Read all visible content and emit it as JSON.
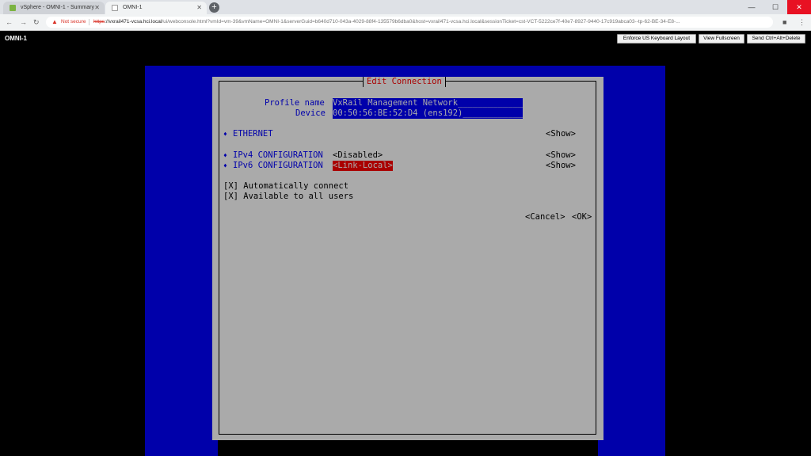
{
  "browser": {
    "tabs": [
      {
        "title": "vSphere - OMNI-1 - Summary",
        "active": false
      },
      {
        "title": "OMNI-1",
        "active": true
      }
    ],
    "security_label": "Not secure",
    "url_scheme": "https",
    "url_host": "://vxrail471-vcsa.hci.local",
    "url_rest": "/ui/webconsole.html?vmId=vm-39&vmName=OMNI-1&serverGuid=b640d710-043a-4029-88f4-135579b6dba0&host=vxrail471-vcsa.hci.local&sessionTicket=cst-VCT-5222ce7f-40e7-8927-9440-17c919abca03--tp-62-BE-34-E8-..."
  },
  "console": {
    "vm_name": "OMNI-1",
    "buttons": {
      "keyboard": "Enforce US Keyboard Layout",
      "fullscreen": "View Fullscreen",
      "cad": "Send Ctrl+Alt+Delete"
    }
  },
  "dialog": {
    "title": "Edit Connection",
    "profile_label": "Profile name",
    "profile_value": "VxRail Management Network_____________",
    "device_label": "Device",
    "device_value": "00:50:56:BE:52:D4 (ens192)____________",
    "ethernet_label": "ETHERNET",
    "ethernet_show": "<Show>",
    "ipv4_label": "IPv4 CONFIGURATION",
    "ipv4_value": "<Disabled>",
    "ipv4_show": "<Show>",
    "ipv6_label": "IPv6 CONFIGURATION",
    "ipv6_value": "<Link-Local>",
    "ipv6_show": "<Show>",
    "auto_connect": "[X] Automatically connect",
    "all_users": "[X] Available to all users",
    "cancel": "<Cancel>",
    "ok": "<OK>"
  },
  "colors": {
    "console_blue": "#0000aa",
    "dialog_gray": "#aaaaaa",
    "selection_red": "#aa0000"
  }
}
